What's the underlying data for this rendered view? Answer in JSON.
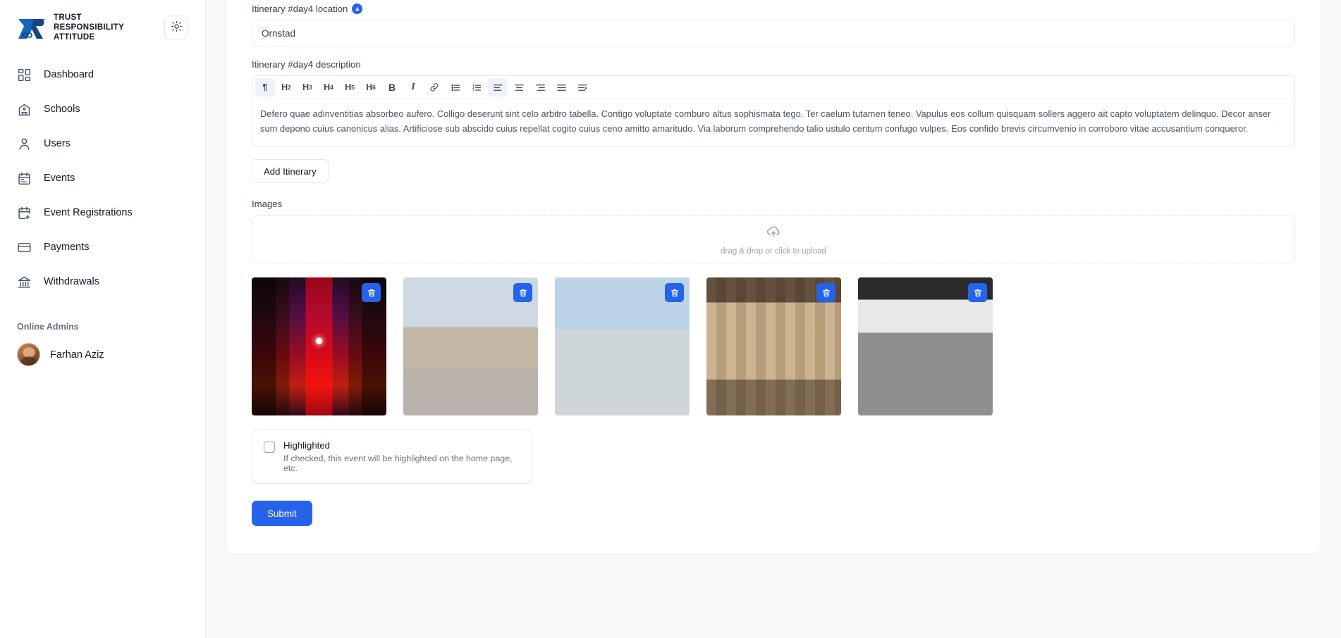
{
  "sidebar": {
    "brand": {
      "line1": "TRUST",
      "line2": "RESPONSIBILITY",
      "line3": "ATTITUDE",
      "text": "TRUST\nRESPONSIBILITY\nATTITUDE"
    },
    "theme_toggle_icon": "sun-icon",
    "items": [
      {
        "label": "Dashboard",
        "icon": "grid-icon"
      },
      {
        "label": "Schools",
        "icon": "school-icon"
      },
      {
        "label": "Users",
        "icon": "user-icon"
      },
      {
        "label": "Events",
        "icon": "calendar-icon"
      },
      {
        "label": "Event Registrations",
        "icon": "calendar-plus-icon"
      },
      {
        "label": "Payments",
        "icon": "credit-card-icon"
      },
      {
        "label": "Withdrawals",
        "icon": "bank-icon"
      }
    ],
    "online_admins_title": "Online Admins",
    "admins": [
      {
        "name": "Farhan Aziz"
      }
    ]
  },
  "form": {
    "location": {
      "label": "Itinerary #day4 location",
      "badge": "▲",
      "value": "Ornstad",
      "placeholder": ""
    },
    "description": {
      "label": "Itinerary #day4 description",
      "toolbar": [
        {
          "name": "paragraph",
          "glyph": "¶",
          "active": true
        },
        {
          "name": "heading-2",
          "glyph": "H",
          "sub": "2",
          "active": false
        },
        {
          "name": "heading-3",
          "glyph": "H",
          "sub": "3",
          "active": false
        },
        {
          "name": "heading-4",
          "glyph": "H",
          "sub": "4",
          "active": false
        },
        {
          "name": "heading-5",
          "glyph": "H",
          "sub": "5",
          "active": false
        },
        {
          "name": "heading-6",
          "glyph": "H",
          "sub": "6",
          "active": false
        },
        {
          "name": "bold",
          "glyph": "B",
          "active": false
        },
        {
          "name": "italic",
          "glyph": "I",
          "active": false
        },
        {
          "name": "link",
          "glyph": "🔗",
          "active": false
        },
        {
          "name": "bullet-list",
          "glyph": "",
          "active": false
        },
        {
          "name": "ordered-list",
          "glyph": "",
          "active": false
        },
        {
          "name": "align-left",
          "glyph": "",
          "active": true
        },
        {
          "name": "align-center",
          "glyph": "",
          "active": false
        },
        {
          "name": "align-right",
          "glyph": "",
          "active": false
        },
        {
          "name": "align-justify",
          "glyph": "",
          "active": false
        },
        {
          "name": "indent",
          "glyph": "",
          "active": false
        }
      ],
      "content": "Defero quae adinventitias absorbeo aufero. Colligo deserunt sint celo arbitro tabella. Contigo voluptate comburo altus sophismata tego. Ter caelum tutamen teneo. Vapulus eos collum quisquam sollers aggero ait capto voluptatem delinquo. Decor anser sum depono cuius canonicus alias. Artificiose sub abscido cuius repellat cogito cuius ceno amitto amaritudo. Via laborum comprehendo talio ustulo centum confugo vulpes. Eos confido brevis circumvenio in corroboro vitae accusantium conqueror."
    },
    "add_itinerary_label": "Add Itinerary",
    "images": {
      "label": "Images",
      "dropzone_text": "drag & drop or click to upload",
      "dropzone_icon": "upload-cloud-icon",
      "delete_icon": "trash-icon",
      "thumbnails": [
        {
          "alt": "cathedral-interior-light-show",
          "style": "ph-cathedral"
        },
        {
          "alt": "domed-building-with-crowd",
          "style": "ph-dome"
        },
        {
          "alt": "white-victorian-house",
          "style": "ph-house"
        },
        {
          "alt": "t-shirt-street-market-stall",
          "style": "ph-shirts"
        },
        {
          "alt": "black-and-white-street-scene",
          "style": "ph-bw"
        }
      ]
    },
    "highlighted": {
      "title": "Highlighted",
      "description": "If checked, this event will be highlighted on the home page, etc.",
      "checked": false
    },
    "submit_label": "Submit"
  },
  "colors": {
    "accent": "#2563eb",
    "border": "#e5e7eb",
    "text": "#111827",
    "muted": "#6b7280"
  }
}
